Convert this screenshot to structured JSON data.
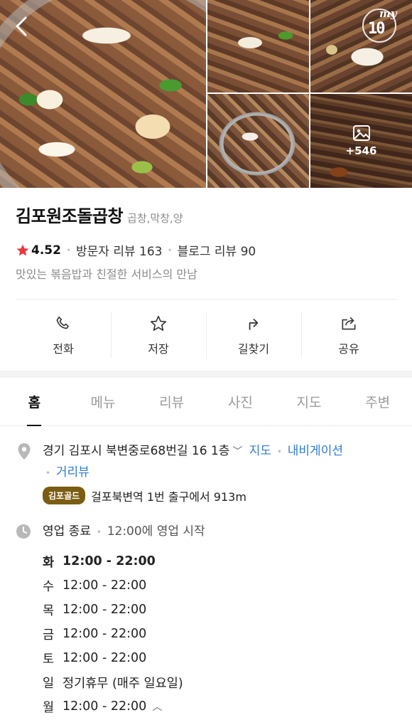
{
  "header": {
    "more_photos_count": "+546",
    "badge_script": "my",
    "badge_number": "10"
  },
  "place": {
    "name": "김포원조돌곱창",
    "category": "곱창,막창,양",
    "rating": "4.52",
    "visitor_reviews": "방문자 리뷰 163",
    "blog_reviews": "블로그 리뷰 90",
    "description": "맛있는 볶음밥과 친절한 서비스의 만남"
  },
  "actions": [
    {
      "label": "전화",
      "icon": "phone-icon"
    },
    {
      "label": "저장",
      "icon": "star-icon"
    },
    {
      "label": "길찾기",
      "icon": "directions-icon"
    },
    {
      "label": "공유",
      "icon": "share-icon"
    }
  ],
  "tabs": [
    "홈",
    "메뉴",
    "리뷰",
    "사진",
    "지도",
    "주변"
  ],
  "address": {
    "text": "경기 김포시 북변중로68번길 16 1층",
    "map_link": "지도",
    "navigation_link": "내비게이션",
    "street_view_link": "거리뷰",
    "subway_badge": "김포골드",
    "subway_text": "걸포북변역 1번 출구에서 913m"
  },
  "hours": {
    "status": "영업 종료",
    "next_open": "12:00에 영업 시작",
    "days": [
      {
        "day": "화",
        "time": "12:00 - 22:00"
      },
      {
        "day": "수",
        "time": "12:00 - 22:00"
      },
      {
        "day": "목",
        "time": "12:00 - 22:00"
      },
      {
        "day": "금",
        "time": "12:00 - 22:00"
      },
      {
        "day": "토",
        "time": "12:00 - 22:00"
      },
      {
        "day": "일",
        "time": "정기휴무 (매주 일요일)"
      },
      {
        "day": "월",
        "time": "12:00 - 22:00"
      }
    ]
  },
  "colors": {
    "star": "#e8383d",
    "link": "#2f7dd1",
    "subway_badge": "#7a5c12"
  }
}
